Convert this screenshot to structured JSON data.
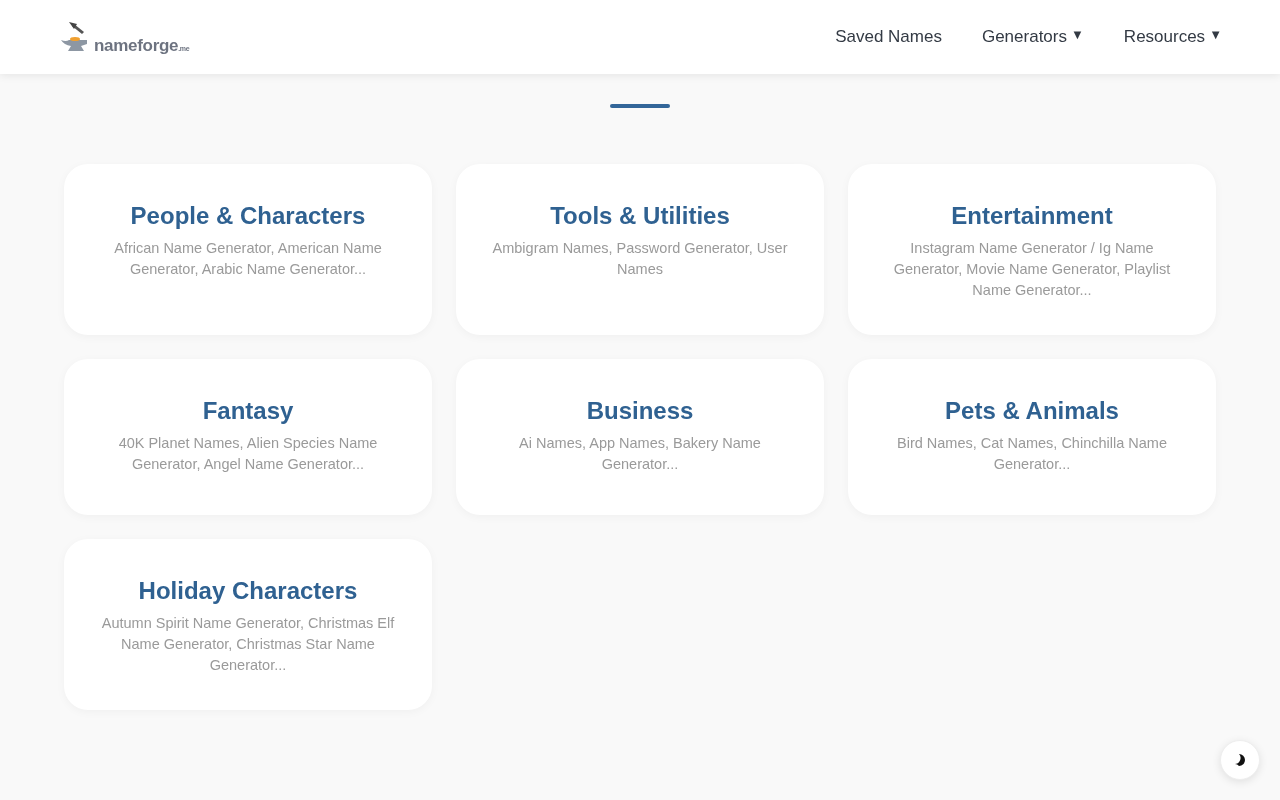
{
  "header": {
    "logo": {
      "name": "nameforge",
      "suffix": ".me"
    },
    "nav": [
      {
        "label": "Saved Names"
      },
      {
        "label": "Generators",
        "caret": "▼"
      },
      {
        "label": "Resources",
        "caret": "▼"
      }
    ]
  },
  "section": {
    "categories": [
      {
        "title": "People & Characters",
        "description": "African Name Generator, American Name Generator, Arabic Name Generator..."
      },
      {
        "title": "Tools & Utilities",
        "description": "Ambigram Names, Password Generator, User Names"
      },
      {
        "title": "Entertainment",
        "description": "Instagram Name Generator / Ig Name Generator, Movie Name Generator, Playlist Name Generator..."
      },
      {
        "title": "Fantasy",
        "description": "40K Planet Names, Alien Species Name Generator, Angel Name Generator..."
      },
      {
        "title": "Business",
        "description": "Ai Names, App Names, Bakery Name Generator..."
      },
      {
        "title": "Pets & Animals",
        "description": "Bird Names, Cat Names, Chinchilla Name Generator..."
      },
      {
        "title": "Holiday Characters",
        "description": "Autumn Spirit Name Generator, Christmas Elf Name Generator, Christmas Star Name Generator..."
      }
    ]
  }
}
